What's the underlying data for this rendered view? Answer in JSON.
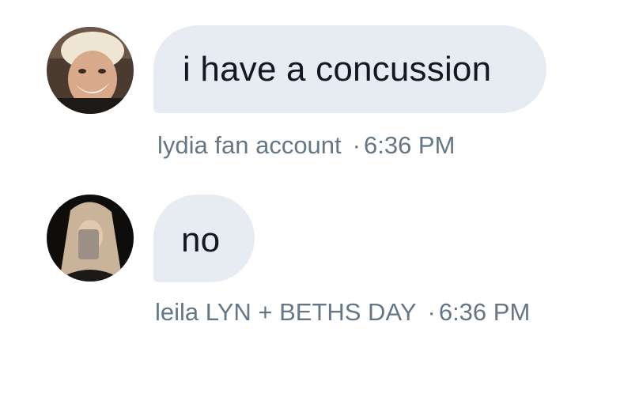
{
  "messages": [
    {
      "text": "i have a concussion",
      "sender": "lydia fan account",
      "separator": "·",
      "time": "6:36 PM",
      "avatar_icon": "user-avatar-photo"
    },
    {
      "text": "no",
      "sender": "leila LYN + BETHS DAY",
      "separator": "·",
      "time": "6:36 PM",
      "avatar_icon": "user-avatar-photo"
    }
  ],
  "colors": {
    "bubble": "#e7ebf2",
    "text": "#141823",
    "meta": "#657786",
    "background": "#ffffff"
  }
}
